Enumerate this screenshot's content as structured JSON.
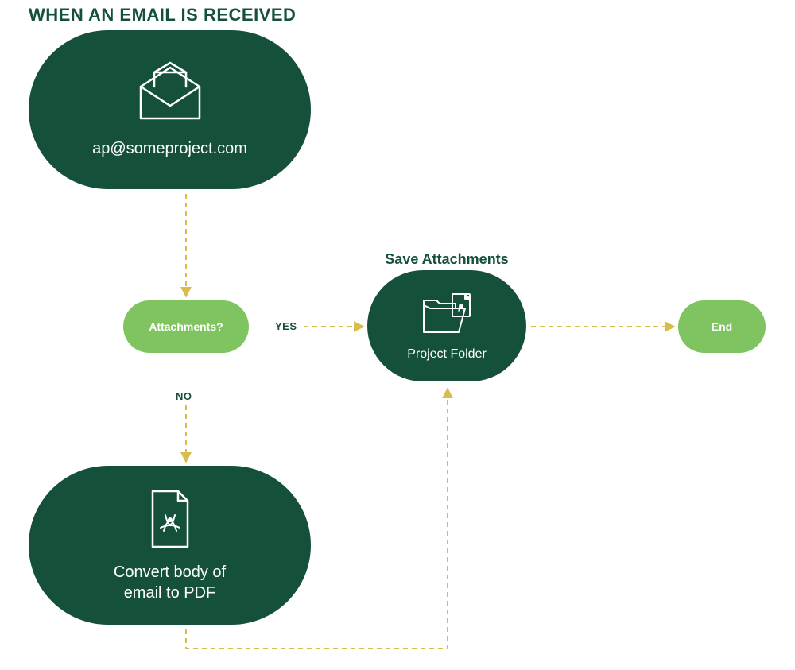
{
  "title": "WHEN AN EMAIL IS RECEIVED",
  "nodes": {
    "email": {
      "label": "ap@someproject.com",
      "icon": "email-open"
    },
    "decision": {
      "label": "Attachments?"
    },
    "save": {
      "title": "Save Attachments",
      "label": "Project Folder",
      "icon": "folder-pdf"
    },
    "convert": {
      "label": "Convert body of\nemail to PDF",
      "icon": "pdf-file"
    },
    "end": {
      "label": "End"
    }
  },
  "edges": {
    "yes": "YES",
    "no": "NO"
  },
  "colors": {
    "dark": "#15503b",
    "light": "#80c361",
    "arrow": "#d7be4c"
  }
}
